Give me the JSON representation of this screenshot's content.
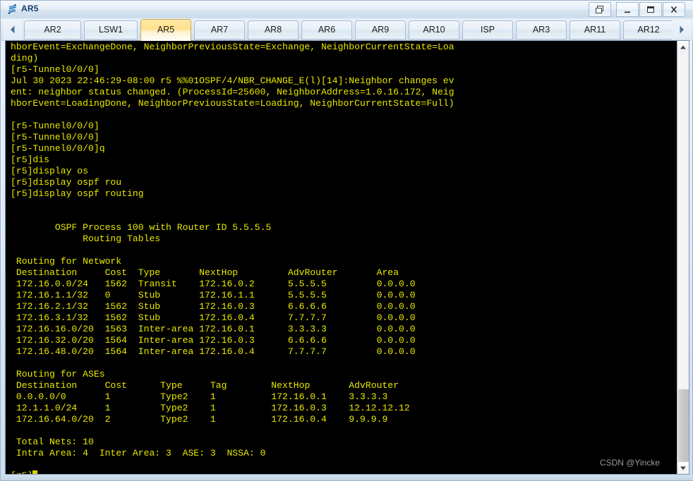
{
  "window": {
    "title": "AR5",
    "icon": "router-icon",
    "controls": [
      {
        "name": "restore-button",
        "label": "Restore",
        "glyph": "restore-icon"
      },
      {
        "name": "minimize-button",
        "label": "Minimize",
        "glyph": "minimize-icon"
      },
      {
        "name": "maximize-button",
        "label": "Maximize",
        "glyph": "maximize-icon"
      },
      {
        "name": "close-button",
        "label": "Close",
        "glyph": "close-icon"
      }
    ]
  },
  "tabbar": {
    "scroll_left_icon": "chevron-left-icon",
    "scroll_right_icon": "chevron-right-icon",
    "active_tab": "AR5",
    "tabs": [
      {
        "label": "AR2",
        "active": false
      },
      {
        "label": "LSW1",
        "active": false
      },
      {
        "label": "AR5",
        "active": true
      },
      {
        "label": "AR7",
        "active": false
      },
      {
        "label": "AR8",
        "active": false
      },
      {
        "label": "AR6",
        "active": false
      },
      {
        "label": "AR9",
        "active": false
      },
      {
        "label": "AR10",
        "active": false
      },
      {
        "label": "ISP",
        "active": false
      },
      {
        "label": "AR3",
        "active": false
      },
      {
        "label": "AR11",
        "active": false
      },
      {
        "label": "AR12",
        "active": false
      }
    ]
  },
  "terminal": {
    "foreground_color": "#e8e800",
    "background_color": "#000000",
    "prompt": "[r5]",
    "content": "hborEvent=ExchangeDone, NeighborPreviousState=Exchange, NeighborCurrentState=Loa\nding)\n[r5-Tunnel0/0/0]\nJul 30 2023 22:46:29-08:00 r5 %%01OSPF/4/NBR_CHANGE_E(l)[14]:Neighbor changes ev\nent: neighbor status changed. (ProcessId=25600, NeighborAddress=1.0.16.172, Neig\nhborEvent=LoadingDone, NeighborPreviousState=Loading, NeighborCurrentState=Full)\n\n[r5-Tunnel0/0/0]\n[r5-Tunnel0/0/0]\n[r5-Tunnel0/0/0]q\n[r5]dis\n[r5]display os\n[r5]display ospf rou\n[r5]display ospf routing\n\n\n        OSPF Process 100 with Router ID 5.5.5.5\n             Routing Tables\n\n Routing for Network\n Destination     Cost  Type       NextHop         AdvRouter       Area\n 172.16.0.0/24   1562  Transit    172.16.0.2      5.5.5.5         0.0.0.0\n 172.16.1.1/32   0     Stub       172.16.1.1      5.5.5.5         0.0.0.0\n 172.16.2.1/32   1562  Stub       172.16.0.3      6.6.6.6         0.0.0.0\n 172.16.3.1/32   1562  Stub       172.16.0.4      7.7.7.7         0.0.0.0\n 172.16.16.0/20  1563  Inter-area 172.16.0.1      3.3.3.3         0.0.0.0\n 172.16.32.0/20  1564  Inter-area 172.16.0.3      6.6.6.6         0.0.0.0\n 172.16.48.0/20  1564  Inter-area 172.16.0.4      7.7.7.7         0.0.0.0\n\n Routing for ASEs\n Destination     Cost      Type     Tag        NextHop       AdvRouter\n 0.0.0.0/0       1         Type2    1          172.16.0.1    3.3.3.3\n 12.1.1.0/24     1         Type2    1          172.16.0.3    12.12.12.12\n 172.16.64.0/20  2         Type2    1          172.16.0.4    9.9.9.9\n\n Total Nets: 10\n Intra Area: 4  Inter Area: 3  ASE: 3  NSSA: 0\n",
    "ospf": {
      "process_id": "100",
      "router_id": "5.5.5.5",
      "heading": "Routing Tables",
      "network_section_title": "Routing for Network",
      "network_headers": [
        "Destination",
        "Cost",
        "Type",
        "NextHop",
        "AdvRouter",
        "Area"
      ],
      "network_rows": [
        [
          "172.16.0.0/24",
          "1562",
          "Transit",
          "172.16.0.2",
          "5.5.5.5",
          "0.0.0.0"
        ],
        [
          "172.16.1.1/32",
          "0",
          "Stub",
          "172.16.1.1",
          "5.5.5.5",
          "0.0.0.0"
        ],
        [
          "172.16.2.1/32",
          "1562",
          "Stub",
          "172.16.0.3",
          "6.6.6.6",
          "0.0.0.0"
        ],
        [
          "172.16.3.1/32",
          "1562",
          "Stub",
          "172.16.0.4",
          "7.7.7.7",
          "0.0.0.0"
        ],
        [
          "172.16.16.0/20",
          "1563",
          "Inter-area",
          "172.16.0.1",
          "3.3.3.3",
          "0.0.0.0"
        ],
        [
          "172.16.32.0/20",
          "1564",
          "Inter-area",
          "172.16.0.3",
          "6.6.6.6",
          "0.0.0.0"
        ],
        [
          "172.16.48.0/20",
          "1564",
          "Inter-area",
          "172.16.0.4",
          "7.7.7.7",
          "0.0.0.0"
        ]
      ],
      "ase_section_title": "Routing for ASEs",
      "ase_headers": [
        "Destination",
        "Cost",
        "Type",
        "Tag",
        "NextHop",
        "AdvRouter"
      ],
      "ase_rows": [
        [
          "0.0.0.0/0",
          "1",
          "Type2",
          "1",
          "172.16.0.1",
          "3.3.3.3"
        ],
        [
          "12.1.1.0/24",
          "1",
          "Type2",
          "1",
          "172.16.0.3",
          "12.12.12.12"
        ],
        [
          "172.16.64.0/20",
          "2",
          "Type2",
          "1",
          "172.16.0.4",
          "9.9.9.9"
        ]
      ],
      "totals": {
        "total_nets": "10",
        "intra_area": "4",
        "inter_area": "3",
        "ase": "3",
        "nssa": "0"
      }
    },
    "commands": [
      "[r5-Tunnel0/0/0]q",
      "[r5]dis",
      "[r5]display os",
      "[r5]display ospf rou",
      "[r5]display ospf routing"
    ]
  },
  "scrollbar": {
    "up_icon": "caret-up-icon",
    "down_icon": "caret-down-icon",
    "thumb_name": "scrollbar-thumb"
  },
  "watermark": {
    "text": "CSDN @Yincke"
  }
}
